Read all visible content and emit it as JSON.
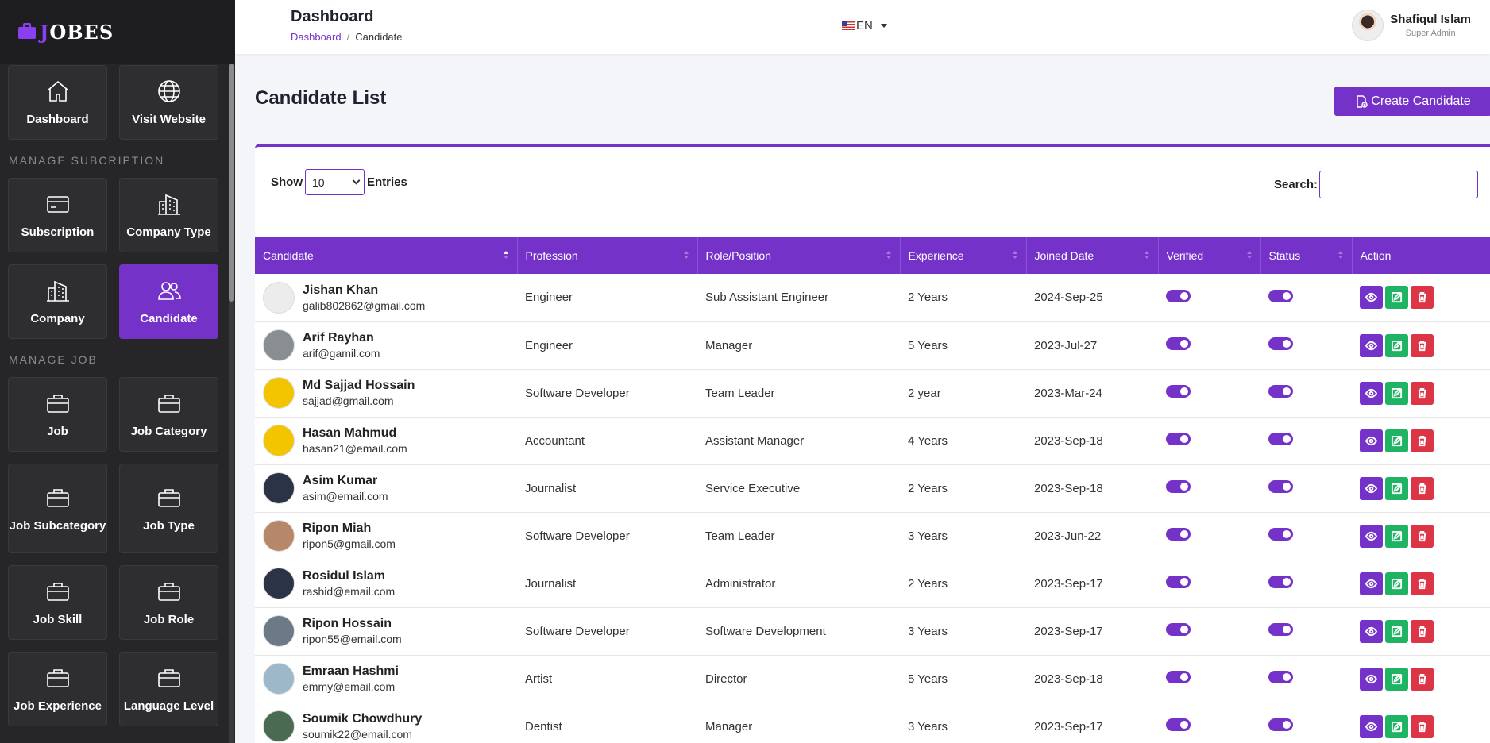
{
  "brand": {
    "name": "OBES",
    "j": "J"
  },
  "sidebar": {
    "top_tiles": [
      {
        "label": "Dashboard",
        "icon": "home-icon",
        "name": "sidebar-item-dashboard"
      },
      {
        "label": "Visit Website",
        "icon": "globe-icon",
        "name": "sidebar-item-visit-website"
      }
    ],
    "sections": [
      {
        "title": "MANAGE SUBCRIPTION",
        "tiles": [
          {
            "label": "Subscription",
            "icon": "credit-card-icon"
          },
          {
            "label": "Company Type",
            "icon": "building-icon"
          },
          {
            "label": "Company",
            "icon": "building-icon"
          },
          {
            "label": "Candidate",
            "icon": "users-icon",
            "active": true
          }
        ]
      },
      {
        "title": "MANAGE JOB",
        "tiles": [
          {
            "label": "Job",
            "icon": "briefcase-icon"
          },
          {
            "label": "Job Category",
            "icon": "briefcase-icon"
          },
          {
            "label": "Job Subcategory",
            "icon": "briefcase-icon",
            "tall": true
          },
          {
            "label": "Job Type",
            "icon": "briefcase-icon",
            "tall": true
          },
          {
            "label": "Job Skill",
            "icon": "briefcase-icon"
          },
          {
            "label": "Job Role",
            "icon": "briefcase-icon"
          },
          {
            "label": "Job Experience",
            "icon": "briefcase-icon"
          },
          {
            "label": "Language Level",
            "icon": "briefcase-icon"
          }
        ]
      }
    ]
  },
  "header": {
    "title": "Dashboard",
    "breadcrumb": {
      "link": "Dashboard",
      "separator": "/",
      "current": "Candidate"
    },
    "language": "EN",
    "user": {
      "name": "Shafiqul Islam",
      "role": "Super Admin"
    }
  },
  "main": {
    "title": "Candidate List",
    "create_button": "Create Candidate",
    "show_label": "Show",
    "entries_value": "10",
    "entries_label": "Entries",
    "search_label": "Search:"
  },
  "table": {
    "columns": [
      "Candidate",
      "Profession",
      "Role/Position",
      "Experience",
      "Joined Date",
      "Verified",
      "Status",
      "Action"
    ],
    "rows": [
      {
        "name": "Jishan Khan",
        "email": "galib802862@gmail.com",
        "profession": "Engineer",
        "role": "Sub Assistant Engineer",
        "experience": "2 Years",
        "joined": "2024-Sep-25",
        "avatar_bg": "#ececec"
      },
      {
        "name": "Arif Rayhan",
        "email": "arif@gamil.com",
        "profession": "Engineer",
        "role": "Manager",
        "experience": "5 Years",
        "joined": "2023-Jul-27",
        "avatar_bg": "#8a8d92"
      },
      {
        "name": "Md Sajjad Hossain",
        "email": "sajjad@gmail.com",
        "profession": "Software Developer",
        "role": "Team Leader",
        "experience": "2 year",
        "joined": "2023-Mar-24",
        "avatar_bg": "#f2c500"
      },
      {
        "name": "Hasan Mahmud",
        "email": "hasan21@email.com",
        "profession": "Accountant",
        "role": "Assistant Manager",
        "experience": "4 Years",
        "joined": "2023-Sep-18",
        "avatar_bg": "#f2c500"
      },
      {
        "name": "Asim Kumar",
        "email": "asim@email.com",
        "profession": "Journalist",
        "role": "Service Executive",
        "experience": "2 Years",
        "joined": "2023-Sep-18",
        "avatar_bg": "#2b3346"
      },
      {
        "name": "Ripon Miah",
        "email": "ripon5@gmail.com",
        "profession": "Software Developer",
        "role": "Team Leader",
        "experience": "3 Years",
        "joined": "2023-Jun-22",
        "avatar_bg": "#b7876a"
      },
      {
        "name": "Rosidul Islam",
        "email": "rashid@email.com",
        "profession": "Journalist",
        "role": "Administrator",
        "experience": "2 Years",
        "joined": "2023-Sep-17",
        "avatar_bg": "#2b3346"
      },
      {
        "name": "Ripon Hossain",
        "email": "ripon55@email.com",
        "profession": "Software Developer",
        "role": "Software Development",
        "experience": "3 Years",
        "joined": "2023-Sep-17",
        "avatar_bg": "#6b7a86"
      },
      {
        "name": "Emraan Hashmi",
        "email": "emmy@email.com",
        "profession": "Artist",
        "role": "Director",
        "experience": "5 Years",
        "joined": "2023-Sep-18",
        "avatar_bg": "#9db8c8"
      },
      {
        "name": "Soumik Chowdhury",
        "email": "soumik22@email.com",
        "profession": "Dentist",
        "role": "Manager",
        "experience": "3 Years",
        "joined": "2023-Sep-17",
        "avatar_bg": "#4a6b52"
      }
    ]
  },
  "colors": {
    "accent": "#7532c9",
    "sidebar_bg": "#262628",
    "edit": "#1fb463",
    "delete": "#dc3545"
  }
}
